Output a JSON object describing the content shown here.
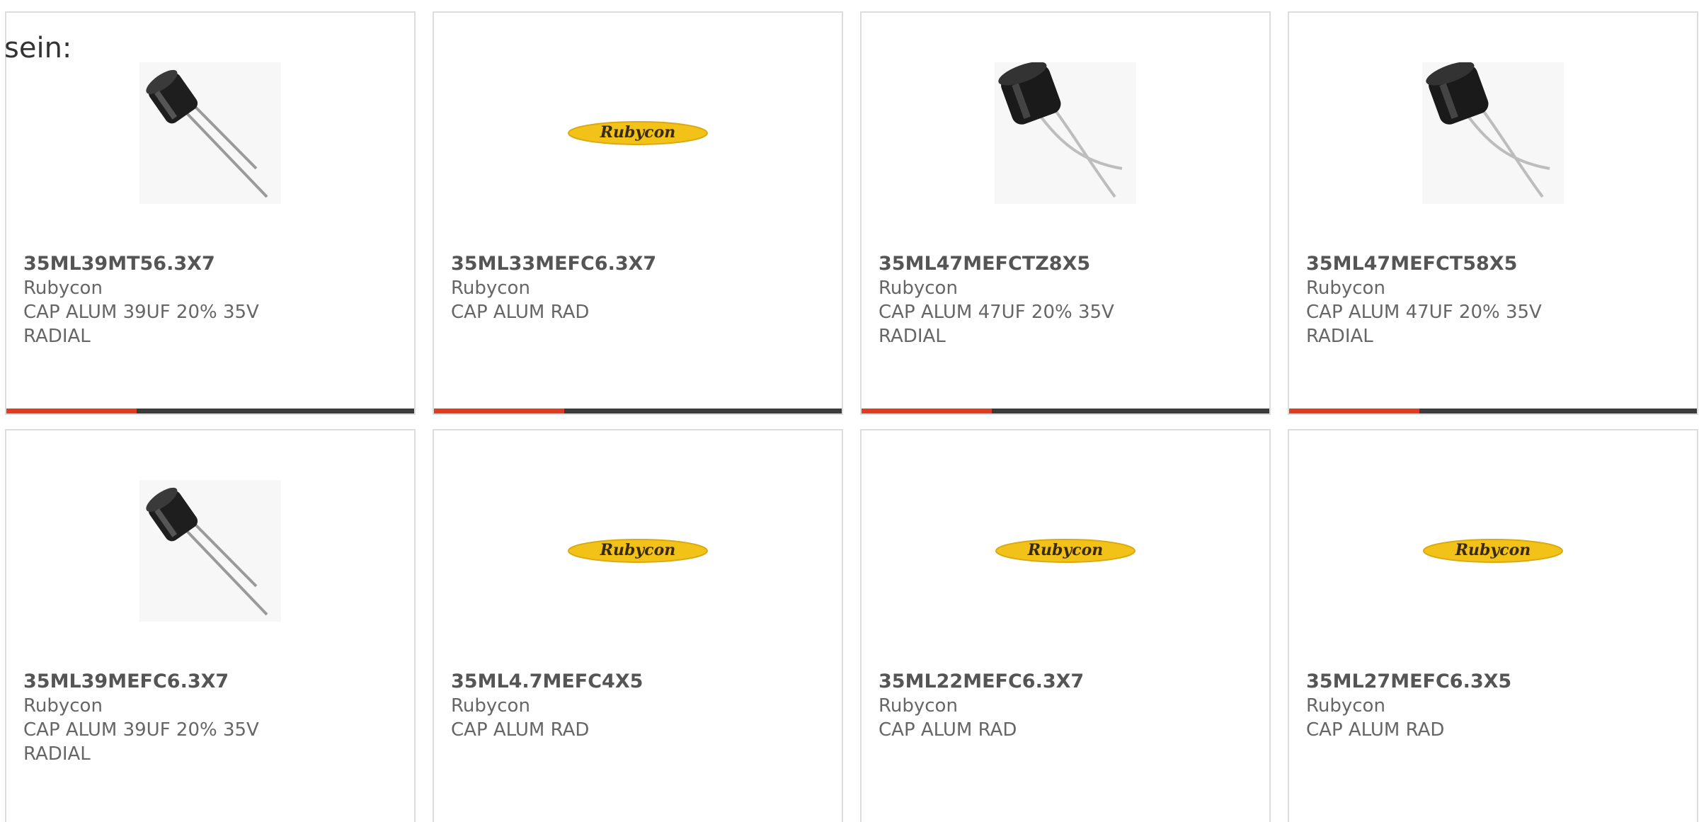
{
  "intro_text": "sein:",
  "colors": {
    "accent": "#e03c1e",
    "bar": "#3b3b3b",
    "logo_yellow": "#f2c218"
  },
  "bar_accent_fraction": 0.32,
  "products": [
    {
      "part_number": "35ML39MT56.3X7",
      "manufacturer": "Rubycon",
      "description_lines": [
        "CAP ALUM 39UF 20% 35V",
        "RADIAL"
      ],
      "image": "capacitor-icon"
    },
    {
      "part_number": "35ML33MEFC6.3X7",
      "manufacturer": "Rubycon",
      "description_lines": [
        "CAP ALUM RAD",
        ""
      ],
      "image": "rubycon-logo",
      "logo_text": "Rubycon"
    },
    {
      "part_number": "35ML47MEFCTZ8X5",
      "manufacturer": "Rubycon",
      "description_lines": [
        "CAP ALUM 47UF 20% 35V",
        "RADIAL"
      ],
      "image": "capacitor-icon"
    },
    {
      "part_number": "35ML47MEFCT58X5",
      "manufacturer": "Rubycon",
      "description_lines": [
        "CAP ALUM 47UF 20% 35V",
        "RADIAL"
      ],
      "image": "capacitor-icon"
    },
    {
      "part_number": "35ML39MEFC6.3X7",
      "manufacturer": "Rubycon",
      "description_lines": [
        "CAP ALUM 39UF 20% 35V",
        "RADIAL"
      ],
      "image": "capacitor-icon"
    },
    {
      "part_number": "35ML4.7MEFC4X5",
      "manufacturer": "Rubycon",
      "description_lines": [
        "CAP ALUM RAD",
        ""
      ],
      "image": "rubycon-logo",
      "logo_text": "Rubycon"
    },
    {
      "part_number": "35ML22MEFC6.3X7",
      "manufacturer": "Rubycon",
      "description_lines": [
        "CAP ALUM RAD",
        ""
      ],
      "image": "rubycon-logo",
      "logo_text": "Rubycon"
    },
    {
      "part_number": "35ML27MEFC6.3X5",
      "manufacturer": "Rubycon",
      "description_lines": [
        "CAP ALUM RAD",
        ""
      ],
      "image": "rubycon-logo",
      "logo_text": "Rubycon"
    }
  ]
}
